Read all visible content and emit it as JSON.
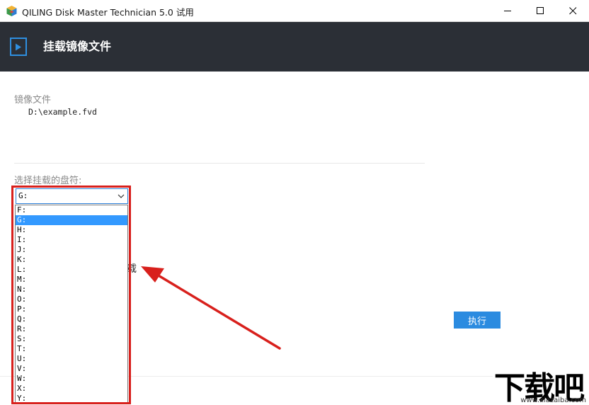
{
  "window": {
    "title": "QILING Disk Master Technician 5.0 试用"
  },
  "header": {
    "title": "挂载镜像文件"
  },
  "image_file": {
    "label": "镜像文件",
    "path": "D:\\example.fvd"
  },
  "drive": {
    "label": "选择挂载的盘符:",
    "selected": "G:",
    "options": [
      "F:",
      "G:",
      "H:",
      "I:",
      "J:",
      "K:",
      "L:",
      "M:",
      "N:",
      "O:",
      "P:",
      "Q:",
      "R:",
      "S:",
      "T:",
      "U:",
      "V:",
      "W:",
      "X:",
      "Y:"
    ],
    "selected_index": 1
  },
  "partial_text": "载",
  "buttons": {
    "execute": "执行"
  },
  "watermark": {
    "brand": "下载吧",
    "url": "www.xiazaiba.com"
  },
  "colors": {
    "header_bg": "#2b2f36",
    "accent": "#2b8be0",
    "annotation": "#d8201c",
    "selection": "#3399ff"
  },
  "icons": {
    "app": "app-cube-icon",
    "header": "play-icon",
    "minimize": "minimize-icon",
    "maximize": "maximize-icon",
    "close": "close-icon",
    "dropdown": "chevron-down-icon"
  }
}
